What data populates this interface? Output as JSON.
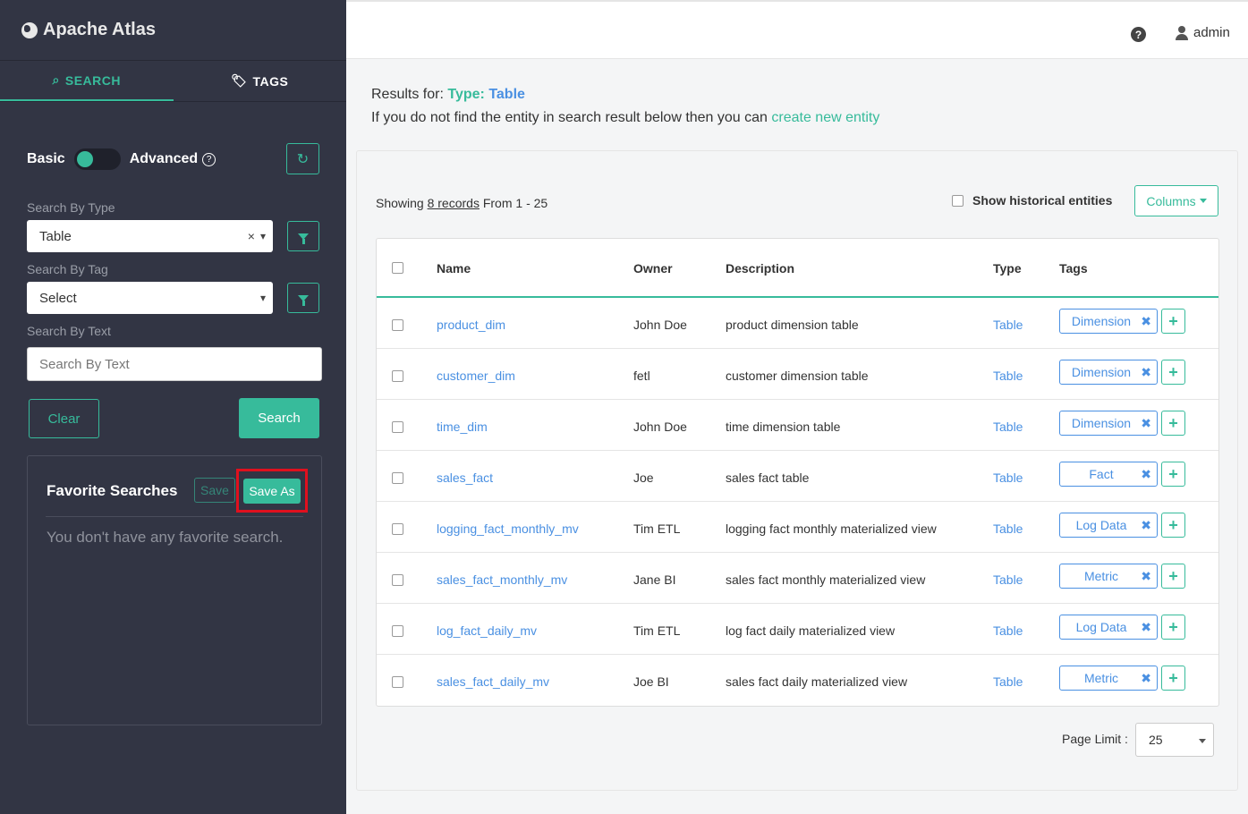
{
  "sidebar": {
    "brand": "Apache Atlas",
    "tabs": {
      "search": "SEARCH",
      "tags": "TAGS"
    },
    "mode": {
      "basic": "Basic",
      "advanced": "Advanced"
    },
    "type_label": "Search By Type",
    "type_value": "Table",
    "tag_label": "Search By Tag",
    "tag_value": "Select",
    "text_label": "Search By Text",
    "text_placeholder": "Search By Text",
    "clear_label": "Clear",
    "search_label": "Search",
    "favorites": {
      "title": "Favorite Searches",
      "save_label": "Save",
      "save_as_label": "Save As",
      "empty_text": "You don't have any favorite search."
    }
  },
  "header": {
    "user": "admin"
  },
  "results": {
    "prefix": "Results for:",
    "type_keyword": "Type:",
    "type_value": "Table",
    "hint_prefix": "If you do not find the entity in search result below then you can",
    "hint_link": "create new entity",
    "showing_prefix": "Showing",
    "records_link": "8 records",
    "showing_suffix": "From 1 - 25",
    "historical_label": "Show historical entities",
    "columns_label": "Columns",
    "page_limit_label": "Page Limit :",
    "page_limit_value": "25"
  },
  "table": {
    "headers": [
      "Name",
      "Owner",
      "Description",
      "Type",
      "Tags"
    ],
    "rows": [
      {
        "name": "product_dim",
        "owner": "John Doe",
        "description": "product dimension table",
        "type": "Table",
        "tag": "Dimension"
      },
      {
        "name": "customer_dim",
        "owner": "fetl",
        "description": "customer dimension table",
        "type": "Table",
        "tag": "Dimension"
      },
      {
        "name": "time_dim",
        "owner": "John Doe",
        "description": "time dimension table",
        "type": "Table",
        "tag": "Dimension"
      },
      {
        "name": "sales_fact",
        "owner": "Joe",
        "description": "sales fact table",
        "type": "Table",
        "tag": "Fact"
      },
      {
        "name": "logging_fact_monthly_mv",
        "owner": "Tim ETL",
        "description": "logging fact monthly materialized view",
        "type": "Table",
        "tag": "Log Data"
      },
      {
        "name": "sales_fact_monthly_mv",
        "owner": "Jane BI",
        "description": "sales fact monthly materialized view",
        "type": "Table",
        "tag": "Metric"
      },
      {
        "name": "log_fact_daily_mv",
        "owner": "Tim ETL",
        "description": "log fact daily materialized view",
        "type": "Table",
        "tag": "Log Data"
      },
      {
        "name": "sales_fact_daily_mv",
        "owner": "Joe BI",
        "description": "sales fact daily materialized view",
        "type": "Table",
        "tag": "Metric"
      }
    ]
  },
  "colors": {
    "accent": "#37bb9b",
    "link": "#4a90e2",
    "sidebar": "#323544",
    "highlight": "#e0101e"
  }
}
